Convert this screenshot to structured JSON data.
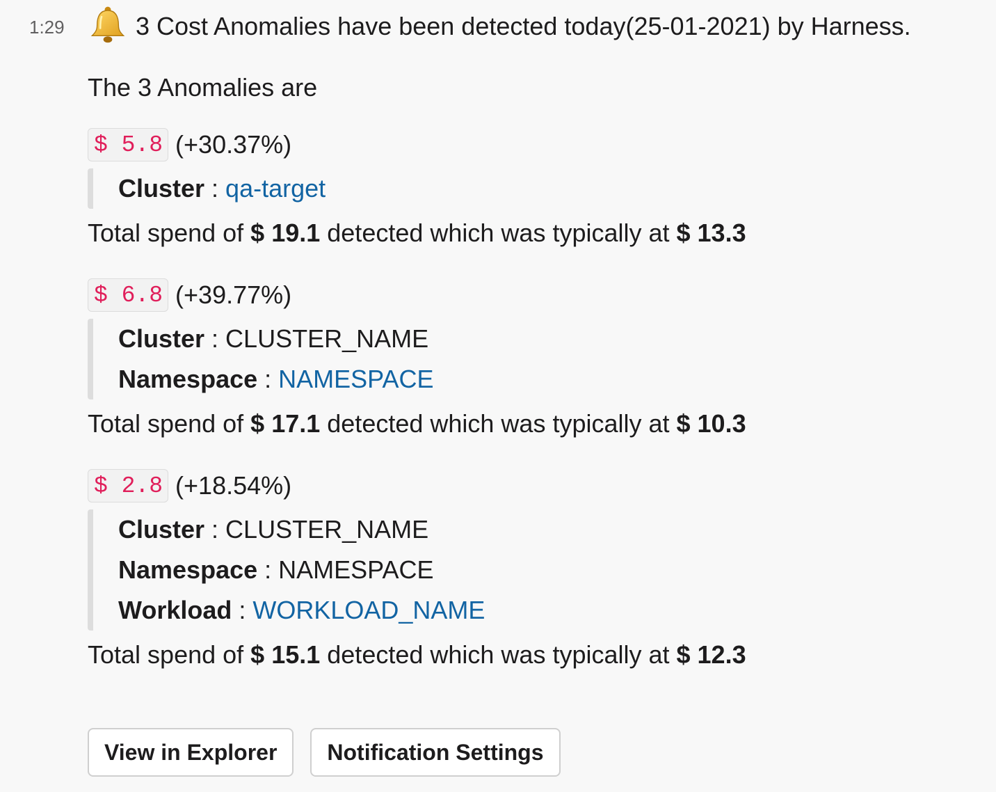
{
  "message": {
    "timestamp": "1:29",
    "icon": "bell-icon",
    "header": "3 Cost Anomalies have been detected today(25-01-2021) by Harness.",
    "intro": "The 3 Anomalies are"
  },
  "anomalies": [
    {
      "cost": "$ 5.8",
      "change": "(+30.37%)",
      "fields": [
        {
          "key": "Cluster",
          "sep": " : ",
          "value": "qa-target",
          "link": true
        }
      ],
      "total_prefix": "Total spend of ",
      "total_amount": "$ 19.1",
      "total_middle": " detected which was typically at ",
      "typical_amount": "$ 13.3"
    },
    {
      "cost": "$ 6.8",
      "change": "(+39.77%)",
      "fields": [
        {
          "key": "Cluster",
          "sep": " : ",
          "value": "CLUSTER_NAME",
          "link": false
        },
        {
          "key": "Namespace",
          "sep": " : ",
          "value": "NAMESPACE",
          "link": true
        }
      ],
      "total_prefix": "Total spend of ",
      "total_amount": "$ 17.1",
      "total_middle": " detected which was typically at ",
      "typical_amount": "$ 10.3"
    },
    {
      "cost": "$ 2.8",
      "change": "(+18.54%)",
      "fields": [
        {
          "key": "Cluster",
          "sep": " : ",
          "value": "CLUSTER_NAME",
          "link": false
        },
        {
          "key": "Namespace",
          "sep": " : ",
          "value": "NAMESPACE",
          "link": false
        },
        {
          "key": "Workload",
          "sep": " : ",
          "value": "WORKLOAD_NAME",
          "link": true
        }
      ],
      "total_prefix": "Total spend of ",
      "total_amount": "$ 15.1",
      "total_middle": " detected which was typically at ",
      "typical_amount": "$ 12.3"
    }
  ],
  "actions": {
    "view_explorer": "View in Explorer",
    "notification_settings": "Notification Settings"
  },
  "colors": {
    "cost_chip_text": "#e01e5a",
    "link": "#1264a3",
    "background": "#f8f8f8"
  }
}
